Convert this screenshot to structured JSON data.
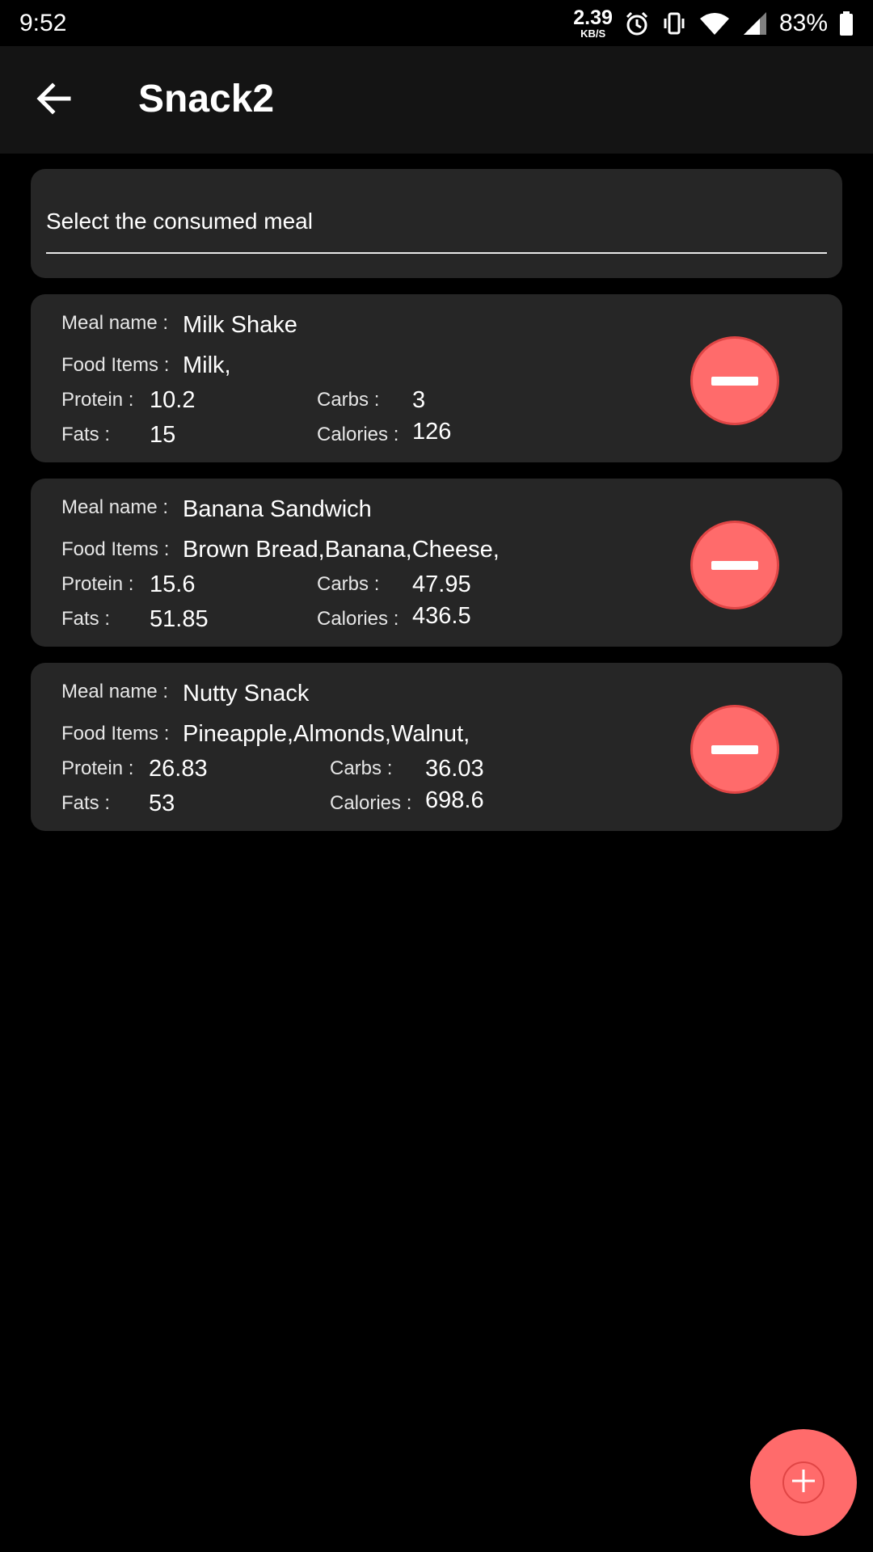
{
  "status_bar": {
    "time": "9:52",
    "net_speed_value": "2.39",
    "net_speed_unit": "KB/S",
    "battery_percent": "83%"
  },
  "app_bar": {
    "title": "Snack2"
  },
  "meal_select": {
    "placeholder": "Select the consumed meal"
  },
  "labels": {
    "meal_name": "Meal name :",
    "food_items": "Food Items :",
    "protein": "Protein :",
    "carbs": "Carbs :",
    "fats": "Fats :",
    "calories": "Calories :"
  },
  "meals": [
    {
      "name": "Milk Shake",
      "food_items": "Milk,",
      "protein": "10.2",
      "carbs": "3",
      "fats": "15",
      "calories": "126"
    },
    {
      "name": "Banana Sandwich",
      "food_items": "Brown Bread,Banana,Cheese,",
      "protein": "15.6",
      "carbs": "47.95",
      "fats": "51.85",
      "calories": "436.5"
    },
    {
      "name": "Nutty Snack",
      "food_items": "Pineapple,Almonds,Walnut,",
      "protein": "26.83",
      "carbs": "36.03",
      "fats": "53",
      "calories": "698.6"
    }
  ],
  "colors": {
    "background": "#000000",
    "app_bar": "#141414",
    "card": "#262626",
    "accent": "#ff6b6b"
  },
  "icons": {
    "back": "arrow-left-icon",
    "remove": "minus-circle-icon",
    "add": "plus-icon"
  }
}
